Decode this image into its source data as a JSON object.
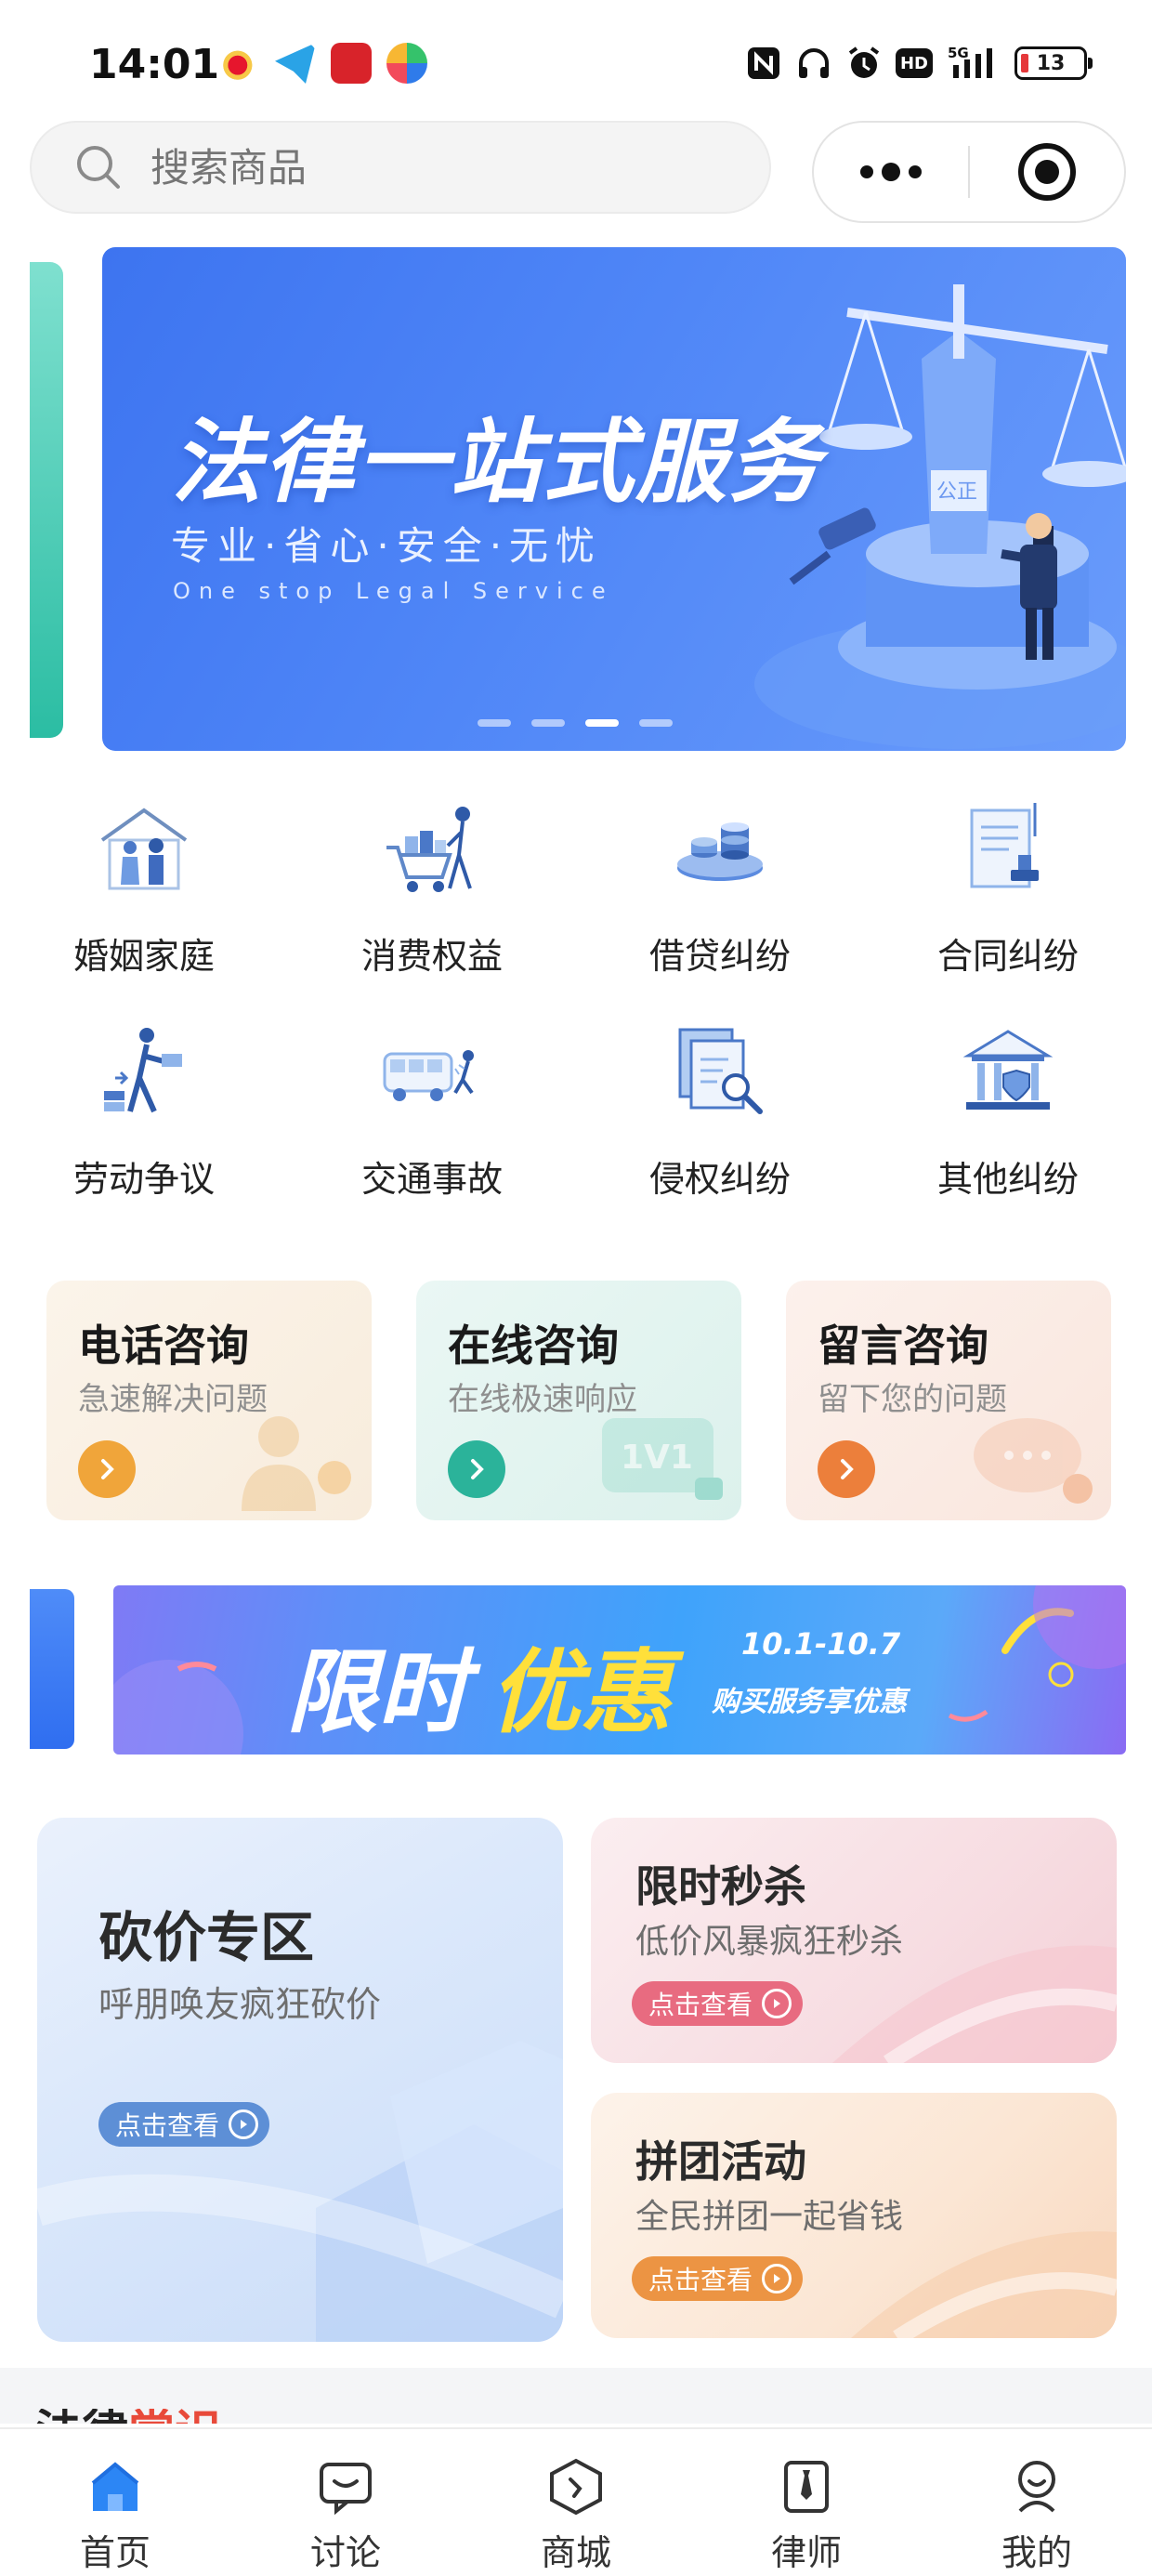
{
  "status_bar": {
    "time": "14:01",
    "network": "5G",
    "hd": "HD",
    "battery": "13"
  },
  "search": {
    "placeholder": "搜索商品"
  },
  "banner": {
    "title": "法律一站式服务",
    "subtitle": "专业·省心·安全·无忧",
    "english": "One stop Legal Service",
    "sign_text": "公正",
    "page_count": 4,
    "active_index": 2
  },
  "categories": [
    {
      "label": "婚姻家庭",
      "icon": "family-icon"
    },
    {
      "label": "消费权益",
      "icon": "shopping-cart-icon"
    },
    {
      "label": "借贷纠纷",
      "icon": "coins-icon"
    },
    {
      "label": "合同纠纷",
      "icon": "contract-stamp-icon"
    },
    {
      "label": "劳动争议",
      "icon": "worker-icon"
    },
    {
      "label": "交通事故",
      "icon": "bus-accident-icon"
    },
    {
      "label": "侵权纠纷",
      "icon": "document-search-icon"
    },
    {
      "label": "其他纠纷",
      "icon": "courthouse-icon"
    }
  ],
  "consult": [
    {
      "title": "电话咨询",
      "subtitle": "急速解决问题",
      "accent": "#f0a53a"
    },
    {
      "title": "在线咨询",
      "subtitle": "在线极速响应",
      "accent": "#2bb39a",
      "deco_text": "1V1"
    },
    {
      "title": "留言咨询",
      "subtitle": "留下您的问题",
      "accent": "#ec7f3b"
    }
  ],
  "promo": {
    "title_white": "限时",
    "title_yellow": "优惠",
    "date": "10.1-10.7",
    "desc": "购买服务享优惠"
  },
  "activities": {
    "bargain": {
      "title": "砍价专区",
      "subtitle": "呼朋唤友疯狂砍价",
      "button": "点击查看",
      "accent": "#5d8fd6"
    },
    "flash_sale": {
      "title": "限时秒杀",
      "subtitle": "低价风暴疯狂秒杀",
      "button": "点击查看",
      "accent": "#e86b80"
    },
    "group_buy": {
      "title": "拼团活动",
      "subtitle": "全民拼团一起省钱",
      "button": "点击查看",
      "accent": "#ec9443"
    }
  },
  "section_peek": {
    "title_a": "法律",
    "title_b": "常识"
  },
  "tabs": [
    {
      "label": "首页",
      "icon": "home-icon",
      "active": true
    },
    {
      "label": "讨论",
      "icon": "chat-icon",
      "active": false
    },
    {
      "label": "商城",
      "icon": "mall-icon",
      "active": false
    },
    {
      "label": "律师",
      "icon": "lawyer-tie-icon",
      "active": false
    },
    {
      "label": "我的",
      "icon": "profile-icon",
      "active": false
    }
  ]
}
